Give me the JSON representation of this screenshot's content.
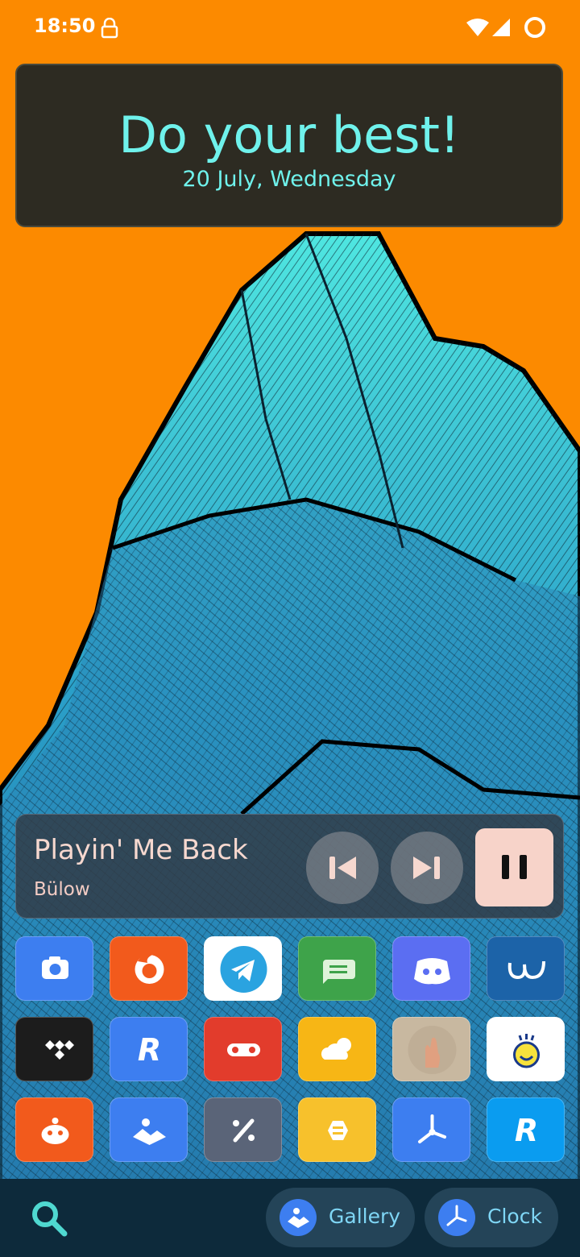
{
  "status_bar": {
    "time": "18:50",
    "icons": [
      "lock-icon",
      "wifi-icon",
      "signal-icon",
      "battery-icon"
    ]
  },
  "quote_widget": {
    "title": "Do your best!",
    "date": "20 July, Wednesday",
    "colors": {
      "background": "#2d2b22",
      "text": "#6ff2ec"
    }
  },
  "media_player": {
    "track_title": "Playin' Me Back",
    "artist": "Bülow",
    "controls": [
      "previous-icon",
      "next-icon",
      "pause-icon"
    ],
    "colors": {
      "text": "#f6d8cf",
      "pause_button": "#f7d3c9"
    }
  },
  "app_grid": {
    "rows": [
      [
        {
          "app": "camera",
          "color": "#3d7ef0"
        },
        {
          "app": "firefox",
          "color": "#f25a1c"
        },
        {
          "app": "telegram",
          "color": "#ffffff"
        },
        {
          "app": "messages",
          "color": "#3ea34a"
        },
        {
          "app": "discord",
          "color": "#5b6ef2"
        },
        {
          "app": "wordmark-app",
          "color": "#1c63a8"
        }
      ],
      [
        {
          "app": "tidal",
          "color": "#1c1c1c"
        },
        {
          "app": "revolut",
          "color": "#3d7ef0"
        },
        {
          "app": "voicemail",
          "color": "#e23c2c"
        },
        {
          "app": "weather",
          "color": "#f7b615"
        },
        {
          "app": "hand-photo",
          "color": "#c8b8a0"
        },
        {
          "app": "smiley",
          "color": "#ffffff"
        }
      ],
      [
        {
          "app": "reddit",
          "color": "#f25a1c"
        },
        {
          "app": "gallery",
          "color": "#3d7ef0"
        },
        {
          "app": "calculator",
          "color": "#5a6478"
        },
        {
          "app": "bumble",
          "color": "#f7c12c"
        },
        {
          "app": "clock",
          "color": "#3d7ef0"
        },
        {
          "app": "revolut-alt",
          "color": "#0a9cf0"
        }
      ]
    ]
  },
  "dock": {
    "search_icon": "search-icon",
    "gallery_label": "Gallery",
    "clock_label": "Clock"
  },
  "colors": {
    "wallpaper_background": "#fc8a00",
    "mountain_light": "#4fe6e0",
    "mountain_dark": "#1f6aa0",
    "dock": "#0d2a3b"
  }
}
